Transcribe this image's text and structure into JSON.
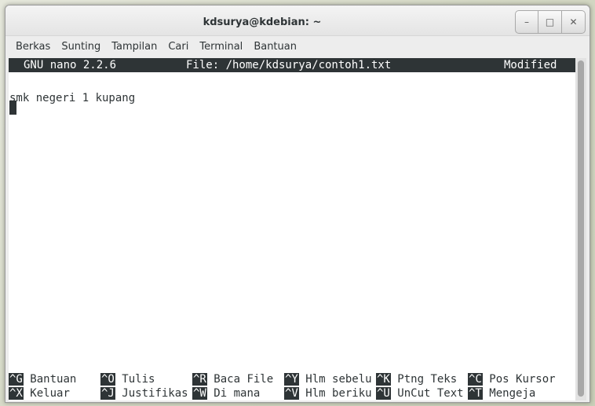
{
  "window": {
    "title": "kdsurya@kdebian: ~",
    "buttons": {
      "minimize_glyph": "–",
      "maximize_glyph": "□",
      "close_glyph": "✕"
    }
  },
  "menubar": {
    "items": [
      "Berkas",
      "Sunting",
      "Tampilan",
      "Cari",
      "Terminal",
      "Bantuan"
    ]
  },
  "nano": {
    "header": {
      "version": "GNU nano 2.2.6",
      "file": "File: /home/kdsurya/contoh1.txt",
      "status": "Modified"
    },
    "content_lines": [
      "smk negeri 1 kupang"
    ],
    "shortcuts_row1": [
      {
        "key": "^G",
        "label": "Bantuan"
      },
      {
        "key": "^O",
        "label": "Tulis"
      },
      {
        "key": "^R",
        "label": "Baca File"
      },
      {
        "key": "^Y",
        "label": "Hlm sebelu"
      },
      {
        "key": "^K",
        "label": "Ptng Teks"
      },
      {
        "key": "^C",
        "label": "Pos Kursor"
      }
    ],
    "shortcuts_row2": [
      {
        "key": "^X",
        "label": "Keluar"
      },
      {
        "key": "^J",
        "label": "Justifikas"
      },
      {
        "key": "^W",
        "label": "Di mana"
      },
      {
        "key": "^V",
        "label": "Hlm beriku"
      },
      {
        "key": "^U",
        "label": "UnCut Text"
      },
      {
        "key": "^T",
        "label": "Mengeja"
      }
    ]
  },
  "colors": {
    "terminal_bg": "#ffffff",
    "terminal_fg": "#2e3436",
    "header_bg": "#2e3436",
    "header_fg": "#ffffff"
  }
}
